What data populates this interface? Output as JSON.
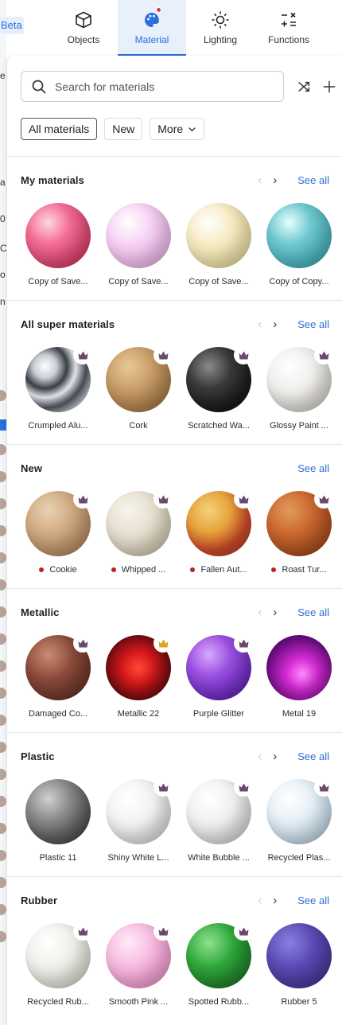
{
  "app": {
    "beta_label": "Beta",
    "left_strip_texts": [
      "e",
      "a",
      "0",
      "C",
      "o",
      "n"
    ]
  },
  "tabs": [
    {
      "label": "Objects",
      "icon": "cube-icon",
      "active": false
    },
    {
      "label": "Material",
      "icon": "palette-icon",
      "active": true
    },
    {
      "label": "Lighting",
      "icon": "sun-icon",
      "active": false
    },
    {
      "label": "Functions",
      "icon": "functions-icon",
      "active": false
    }
  ],
  "search": {
    "placeholder": "Search for materials"
  },
  "filters": [
    {
      "label": "All materials",
      "active": true
    },
    {
      "label": "New",
      "active": false
    },
    {
      "label": "More",
      "active": false
    }
  ],
  "see_all_label": "See all",
  "colors": {
    "accent": "#2a6fdb",
    "crown_purple": "#6b4a6e",
    "crown_gold": "#e3a32a",
    "new_dot": "#b3261e"
  },
  "sections": [
    {
      "title": "My materials",
      "arrows": true,
      "items": [
        {
          "name": "Copy of Save...",
          "crown": ""
        },
        {
          "name": "Copy of Save...",
          "crown": ""
        },
        {
          "name": "Copy of Save...",
          "crown": ""
        },
        {
          "name": "Copy of Copy...",
          "crown": ""
        }
      ]
    },
    {
      "title": "All super materials",
      "arrows": true,
      "items": [
        {
          "name": "Crumpled Alu...",
          "crown": "purple"
        },
        {
          "name": "Cork",
          "crown": "purple"
        },
        {
          "name": "Scratched Wa...",
          "crown": "purple"
        },
        {
          "name": "Glossy Paint ...",
          "crown": "purple"
        }
      ]
    },
    {
      "title": "New",
      "arrows": false,
      "items": [
        {
          "name": "Cookie",
          "crown": "purple",
          "new": true
        },
        {
          "name": "Whipped ...",
          "crown": "purple",
          "new": true
        },
        {
          "name": "Fallen Aut...",
          "crown": "purple",
          "new": true
        },
        {
          "name": "Roast Tur...",
          "crown": "purple",
          "new": true
        }
      ]
    },
    {
      "title": "Metallic",
      "arrows": true,
      "items": [
        {
          "name": "Damaged Co...",
          "crown": "purple"
        },
        {
          "name": "Metallic 22",
          "crown": "gold"
        },
        {
          "name": "Purple Glitter",
          "crown": "purple"
        },
        {
          "name": "Metal 19",
          "crown": ""
        }
      ]
    },
    {
      "title": "Plastic",
      "arrows": true,
      "items": [
        {
          "name": "Plastic 11",
          "crown": ""
        },
        {
          "name": "Shiny White L...",
          "crown": "purple"
        },
        {
          "name": "White Bubble ...",
          "crown": "purple"
        },
        {
          "name": "Recycled Plas...",
          "crown": "purple"
        }
      ]
    },
    {
      "title": "Rubber",
      "arrows": true,
      "items": [
        {
          "name": "Recycled Rub...",
          "crown": "purple"
        },
        {
          "name": "Smooth Pink ...",
          "crown": "purple"
        },
        {
          "name": "Spotted Rubb...",
          "crown": "purple"
        },
        {
          "name": "Rubber 5",
          "crown": ""
        }
      ]
    }
  ]
}
